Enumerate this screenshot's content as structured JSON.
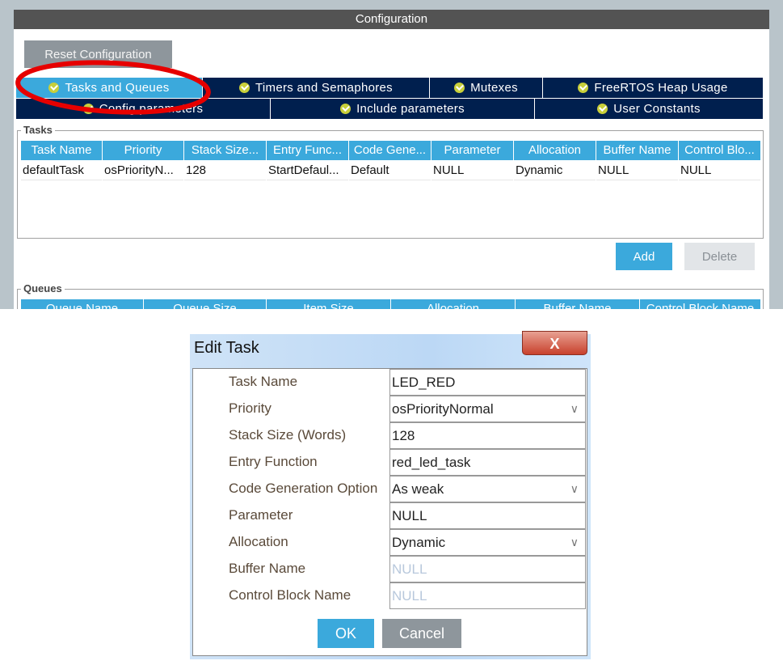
{
  "config": {
    "title": "Configuration",
    "reset_label": "Reset Configuration",
    "tabs_row1": [
      "Tasks and Queues",
      "Timers and Semaphores",
      "Mutexes",
      "FreeRTOS Heap Usage"
    ],
    "tabs_row2": [
      "Config parameters",
      "Include parameters",
      "User Constants"
    ],
    "active_tab": "Tasks and Queues"
  },
  "tasks": {
    "legend": "Tasks",
    "columns": [
      "Task Name",
      "Priority",
      "Stack Size...",
      "Entry Func...",
      "Code Gene...",
      "Parameter",
      "Allocation",
      "Buffer Name",
      "Control Blo..."
    ],
    "rows": [
      [
        "defaultTask",
        "osPriorityN...",
        "128",
        "StartDefaul...",
        "Default",
        "NULL",
        "Dynamic",
        "NULL",
        "NULL"
      ]
    ],
    "add_label": "Add",
    "delete_label": "Delete"
  },
  "queues": {
    "legend": "Queues",
    "columns": [
      "Queue Name",
      "Queue Size",
      "Item Size",
      "Allocation",
      "Buffer Name",
      "Control Block Name"
    ]
  },
  "dialog": {
    "title": "Edit Task",
    "close_label": "X",
    "fields": [
      {
        "label": "Task Name",
        "value": "LED_RED"
      },
      {
        "label": "Priority",
        "value": "osPriorityNormal",
        "dropdown": true
      },
      {
        "label": "Stack Size (Words)",
        "value": "128"
      },
      {
        "label": "Entry Function",
        "value": "red_led_task"
      },
      {
        "label": "Code Generation Option",
        "value": "As weak",
        "dropdown": true
      },
      {
        "label": "Parameter",
        "value": "NULL"
      },
      {
        "label": "Allocation",
        "value": "Dynamic",
        "dropdown": true
      },
      {
        "label": "Buffer Name",
        "value": "NULL",
        "placeholder": true
      },
      {
        "label": "Control Block Name",
        "value": "NULL",
        "placeholder": true
      }
    ],
    "ok_label": "OK",
    "cancel_label": "Cancel"
  },
  "colors": {
    "accent": "#3ba9dc",
    "tab_bg": "#001f4e",
    "highlight_ellipse": "#e60000"
  }
}
